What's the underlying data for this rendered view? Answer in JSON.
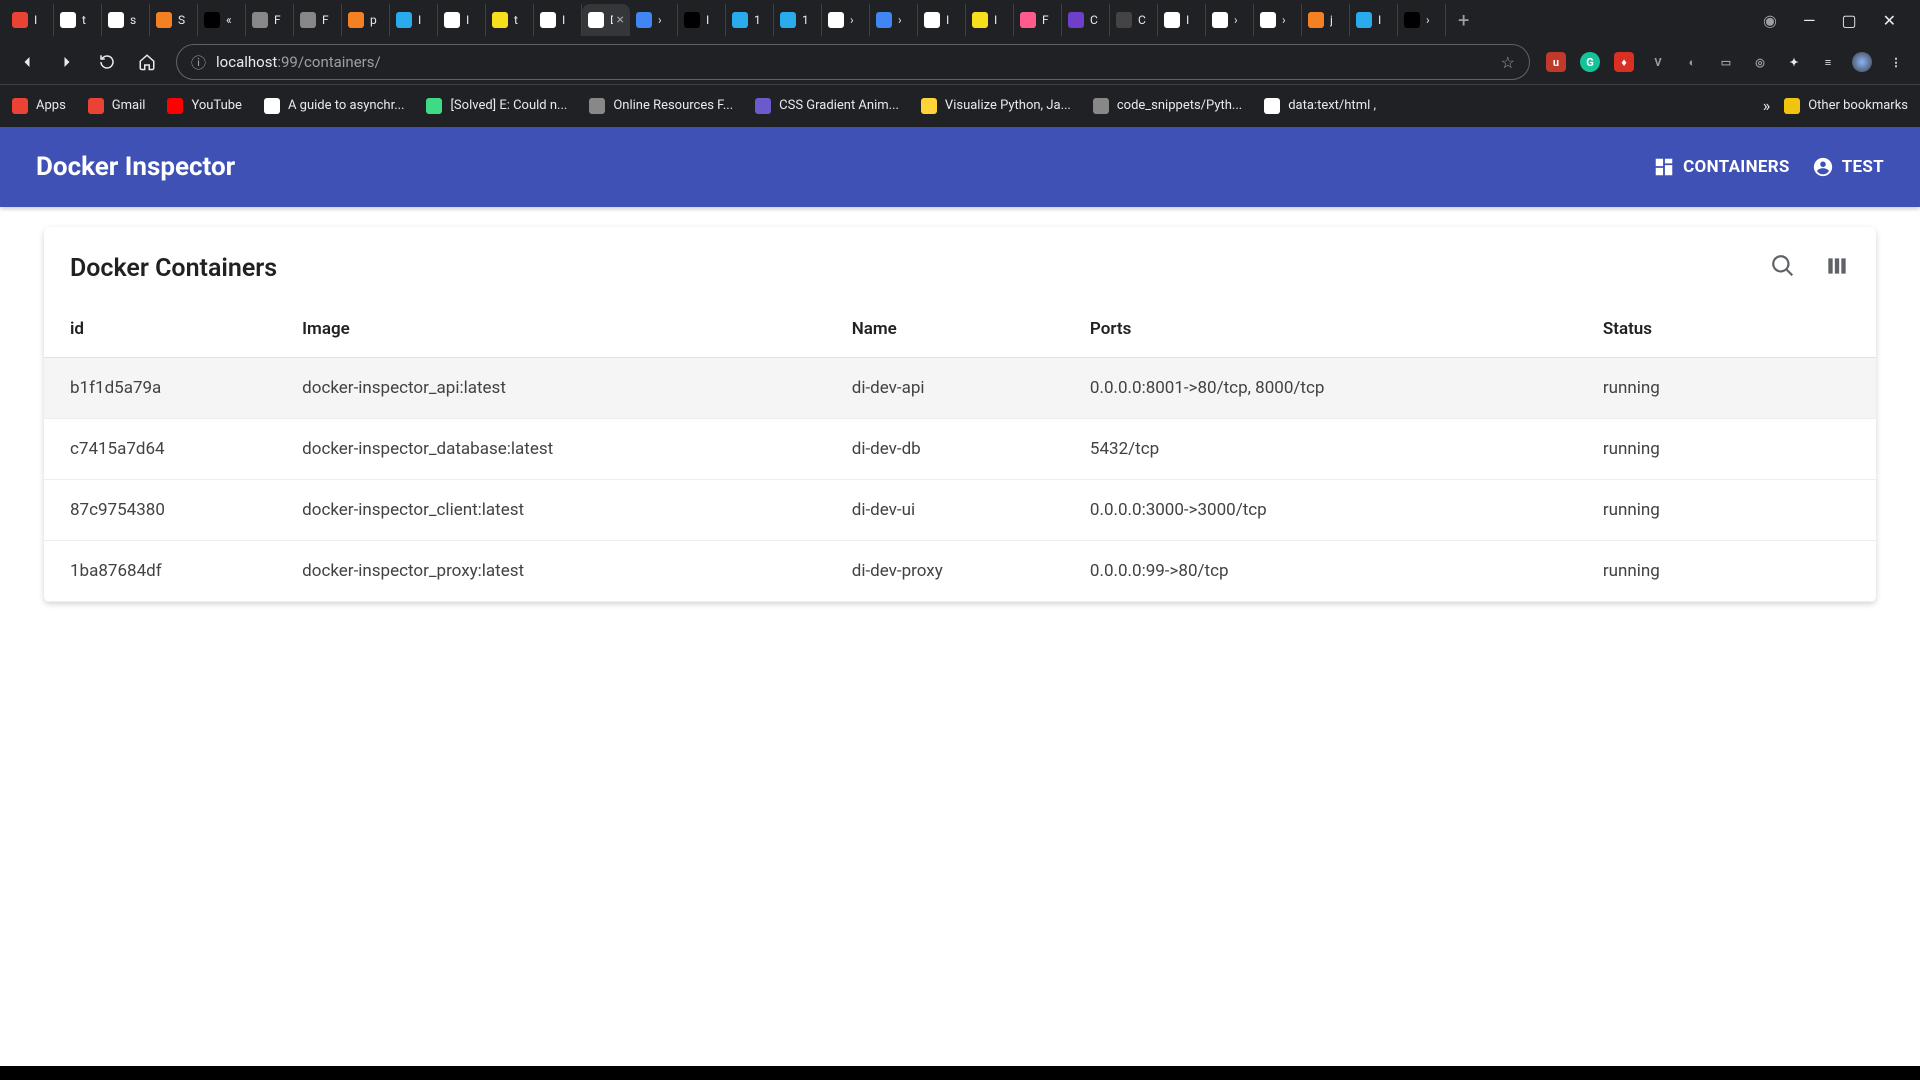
{
  "browser": {
    "tabs": [
      {
        "label": "I",
        "ico": "#ea4335"
      },
      {
        "label": "t",
        "ico": "#ffffff"
      },
      {
        "label": "s",
        "ico": "#ffffff"
      },
      {
        "label": "S",
        "ico": "#f48024"
      },
      {
        "label": "«",
        "ico": "#000000"
      },
      {
        "label": "F",
        "ico": "#888888"
      },
      {
        "label": "F",
        "ico": "#888888"
      },
      {
        "label": "p",
        "ico": "#f48024"
      },
      {
        "label": "I",
        "ico": "#2aabee"
      },
      {
        "label": "I",
        "ico": "#ffffff"
      },
      {
        "label": "t",
        "ico": "#f7df1e"
      },
      {
        "label": "I",
        "ico": "#ffffff"
      },
      {
        "label": "D",
        "ico": "#ffffff",
        "active": true
      },
      {
        "label": "›",
        "ico": "#4285f4"
      },
      {
        "label": "I",
        "ico": "#000000"
      },
      {
        "label": "1",
        "ico": "#2aabee"
      },
      {
        "label": "1",
        "ico": "#2aabee"
      },
      {
        "label": "›",
        "ico": "#ffffff"
      },
      {
        "label": "›",
        "ico": "#4285f4"
      },
      {
        "label": "I",
        "ico": "#ffffff"
      },
      {
        "label": "I",
        "ico": "#f7df1e"
      },
      {
        "label": "F",
        "ico": "#ff5c8d"
      },
      {
        "label": "C",
        "ico": "#6e40c9"
      },
      {
        "label": "C",
        "ico": "#444444"
      },
      {
        "label": "I",
        "ico": "#ffffff"
      },
      {
        "label": "›",
        "ico": "#ffffff"
      },
      {
        "label": "›",
        "ico": "#ffffff"
      },
      {
        "label": "j",
        "ico": "#f48024"
      },
      {
        "label": "I",
        "ico": "#2aabee"
      },
      {
        "label": "›",
        "ico": "#000000"
      }
    ],
    "url_host": "localhost",
    "url_port": ":99",
    "url_path": "/containers/",
    "bookmarks": [
      {
        "label": "Apps",
        "ico": "#ea4335"
      },
      {
        "label": "Gmail",
        "ico": "#ea4335"
      },
      {
        "label": "YouTube",
        "ico": "#ff0000"
      },
      {
        "label": "A guide to asynchr...",
        "ico": "#ffffff"
      },
      {
        "label": "[Solved] E: Could n...",
        "ico": "#3ddc84"
      },
      {
        "label": "Online Resources F...",
        "ico": "#888888"
      },
      {
        "label": "CSS Gradient Anim...",
        "ico": "#6a5acd"
      },
      {
        "label": "Visualize Python, Ja...",
        "ico": "#ffd43b"
      },
      {
        "label": "code_snippets/Pyth...",
        "ico": "#888888"
      },
      {
        "label": "data:text/html ,<ht...",
        "ico": "#ffffff"
      }
    ],
    "other_bookmarks": "Other bookmarks"
  },
  "appbar": {
    "title": "Docker Inspector",
    "link_containers": "CONTAINERS",
    "link_test": "TEST"
  },
  "card": {
    "title": "Docker Containers",
    "columns": {
      "id": "id",
      "image": "Image",
      "name": "Name",
      "ports": "Ports",
      "status": "Status"
    },
    "rows": [
      {
        "id": "b1f1d5a79a",
        "image": "docker-inspector_api:latest",
        "name": "di-dev-api",
        "ports": "0.0.0.0:8001->80/tcp, 8000/tcp",
        "status": "running",
        "hover": true
      },
      {
        "id": "c7415a7d64",
        "image": "docker-inspector_database:latest",
        "name": "di-dev-db",
        "ports": "5432/tcp",
        "status": "running"
      },
      {
        "id": "87c9754380",
        "image": "docker-inspector_client:latest",
        "name": "di-dev-ui",
        "ports": "0.0.0.0:3000->3000/tcp",
        "status": "running"
      },
      {
        "id": "1ba87684df",
        "image": "docker-inspector_proxy:latest",
        "name": "di-dev-proxy",
        "ports": "0.0.0.0:99->80/tcp",
        "status": "running"
      }
    ]
  }
}
